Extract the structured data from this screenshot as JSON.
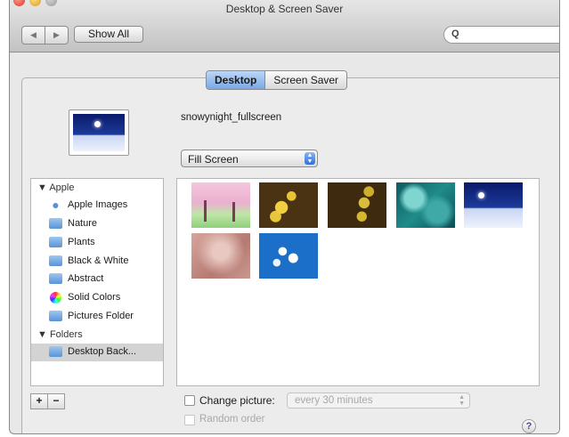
{
  "window": {
    "title": "Desktop & Screen Saver",
    "show_all_label": "Show All",
    "search": {
      "icon": "search-icon",
      "placeholder": ""
    }
  },
  "tabs": [
    {
      "label": "Desktop",
      "selected": true
    },
    {
      "label": "Screen Saver",
      "selected": false
    }
  ],
  "current_picture": {
    "name": "snowynight_fullscreen"
  },
  "fit_option": {
    "selected": "Fill Screen"
  },
  "sidebar": {
    "groups": [
      {
        "label": "▼ Apple",
        "items": [
          {
            "label": "Apple Images",
            "icon": "apple-icon"
          },
          {
            "label": "Nature",
            "icon": "folder-icon"
          },
          {
            "label": "Plants",
            "icon": "folder-icon"
          },
          {
            "label": "Black & White",
            "icon": "folder-icon"
          },
          {
            "label": "Abstract",
            "icon": "folder-icon"
          },
          {
            "label": "Solid Colors",
            "icon": "color-wheel-icon"
          },
          {
            "label": "Pictures Folder",
            "icon": "folder-icon"
          }
        ]
      },
      {
        "label": "▼ Folders",
        "items": [
          {
            "label": "Desktop Back...",
            "icon": "folder-icon",
            "selected": true
          }
        ]
      }
    ],
    "add_label": "+",
    "remove_label": "−"
  },
  "thumbnails": [
    {
      "name": "cherry-blossom-thumb"
    },
    {
      "name": "yellow-flowers-thumb"
    },
    {
      "name": "yellow-flowers-dark-thumb"
    },
    {
      "name": "teal-bokeh-thumb"
    },
    {
      "name": "snowy-night-thumb",
      "selected": true
    },
    {
      "name": "pink-texture-thumb"
    },
    {
      "name": "blue-floral-thumb"
    }
  ],
  "change_picture": {
    "label": "Change picture:",
    "checked": false,
    "interval": "every 30 minutes",
    "random_label": "Random order"
  },
  "help_label": "?"
}
